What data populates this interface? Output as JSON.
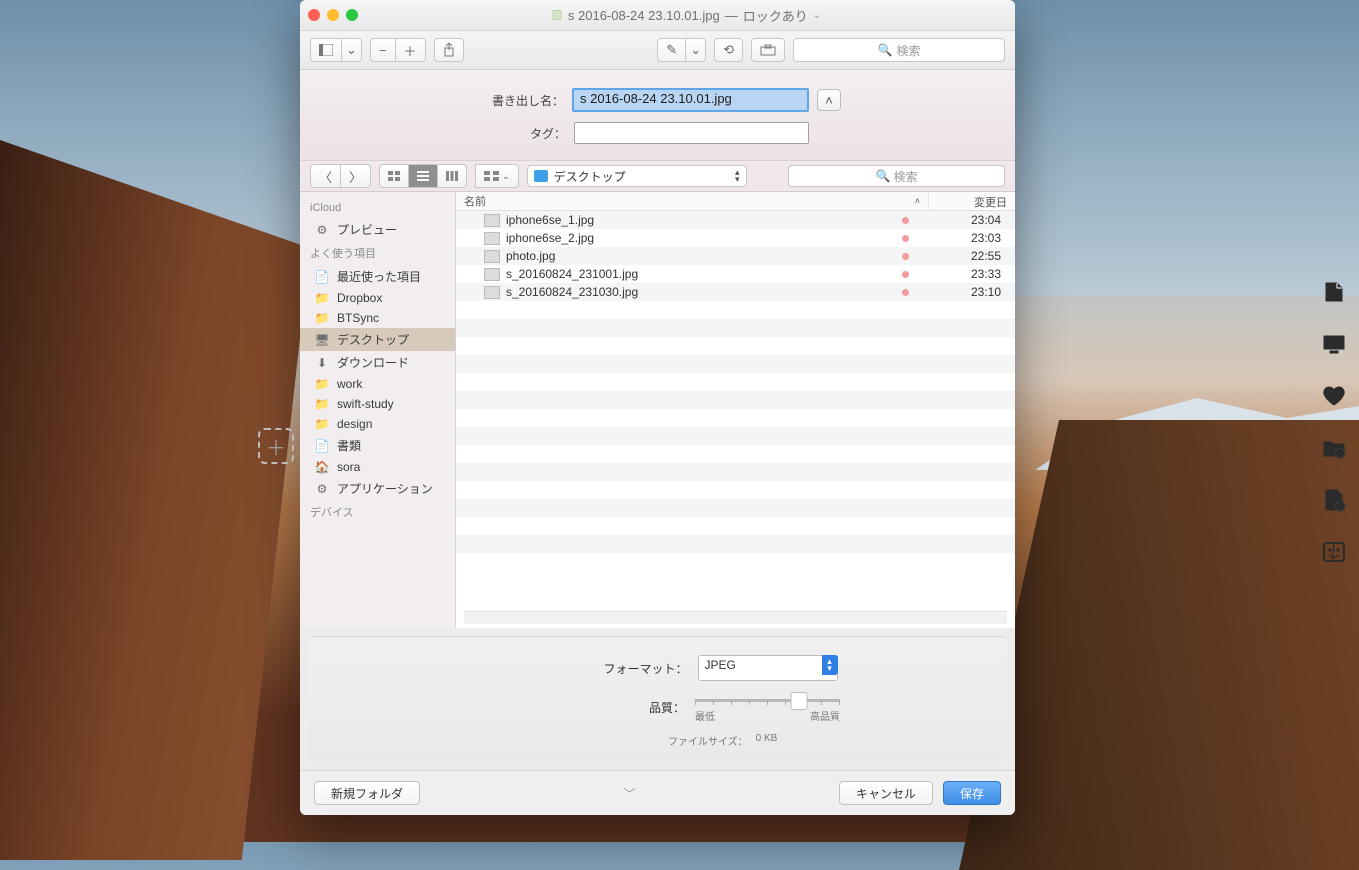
{
  "titlebar": {
    "filename": "s 2016-08-24 23.10.01.jpg",
    "locked_label": "ロックあり"
  },
  "toolbar": {
    "search_placeholder": "検索"
  },
  "save_sheet": {
    "export_name_label": "書き出し名：",
    "export_name_value": "s 2016-08-24 23.10.01.jpg",
    "tags_label": "タグ："
  },
  "browser_bar": {
    "location": "デスクトップ",
    "search_placeholder": "検索"
  },
  "sidebar": {
    "section_icloud": "iCloud",
    "section_fav": "よく使う項目",
    "section_dev": "デバイス",
    "items_icloud": [
      {
        "label": "プレビュー",
        "icon": "app"
      }
    ],
    "items_fav": [
      {
        "label": "最近使った項目",
        "icon": "doc"
      },
      {
        "label": "Dropbox",
        "icon": "folder"
      },
      {
        "label": "BTSync",
        "icon": "folder"
      },
      {
        "label": "デスクトップ",
        "icon": "desktop",
        "selected": true
      },
      {
        "label": "ダウンロード",
        "icon": "download"
      },
      {
        "label": "work",
        "icon": "folder"
      },
      {
        "label": "swift-study",
        "icon": "folder"
      },
      {
        "label": "design",
        "icon": "folder"
      },
      {
        "label": "書類",
        "icon": "doc"
      },
      {
        "label": "sora",
        "icon": "home"
      },
      {
        "label": "アプリケーション",
        "icon": "app"
      }
    ]
  },
  "file_list": {
    "col_name": "名前",
    "col_modified": "変更日",
    "rows": [
      {
        "name": "iphone6se_1.jpg",
        "time": "23:04"
      },
      {
        "name": "iphone6se_2.jpg",
        "time": "23:03"
      },
      {
        "name": "photo.jpg",
        "time": "22:55"
      },
      {
        "name": "s_20160824_231001.jpg",
        "time": "23:33"
      },
      {
        "name": "s_20160824_231030.jpg",
        "time": "23:10"
      }
    ]
  },
  "options": {
    "format_label": "フォーマット：",
    "format_value": "JPEG",
    "quality_label": "品質：",
    "quality_low": "最低",
    "quality_high": "高品質",
    "filesize_label": "ファイルサイズ：",
    "filesize_value": "0 KB"
  },
  "footer": {
    "new_folder": "新規フォルダ",
    "cancel": "キャンセル",
    "save": "保存"
  }
}
